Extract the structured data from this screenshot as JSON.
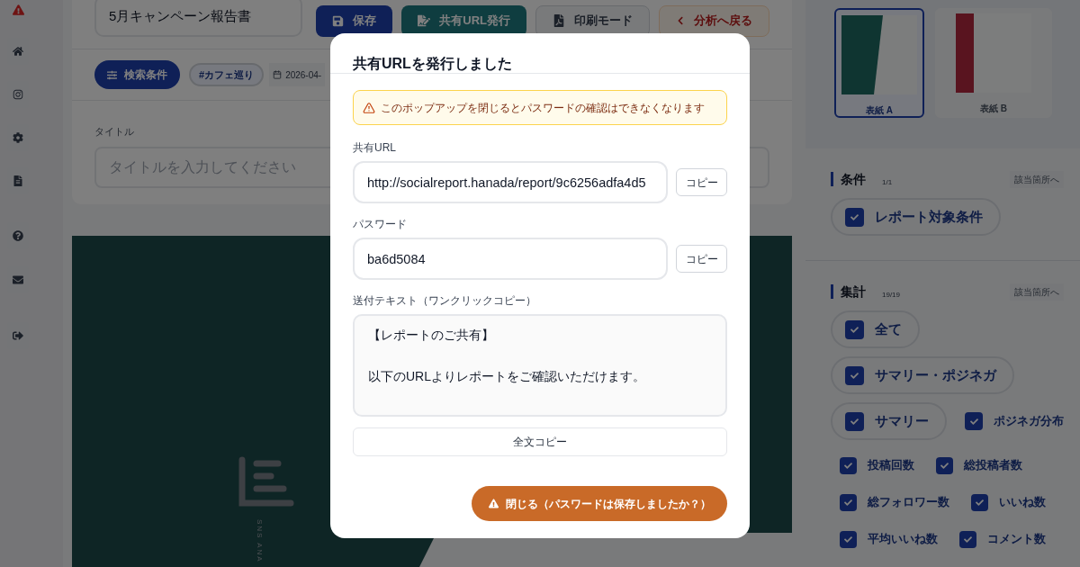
{
  "header": {
    "title_value": "5月キャンペーン報告書",
    "buttons": [
      {
        "label": "保存",
        "kind": "save"
      },
      {
        "label": "共有URL発行",
        "kind": "share"
      },
      {
        "label": "印刷モード",
        "kind": "print"
      },
      {
        "label": "分析へ戻る",
        "kind": "back"
      }
    ]
  },
  "filters": {
    "button": "検索条件",
    "tag": "#カフェ巡り",
    "date": "2026-04-"
  },
  "title_field": {
    "label": "タイトル",
    "placeholder": "タイトルを入力してください"
  },
  "cover_preview": {
    "caption": "SNS ANA"
  },
  "covers": [
    {
      "label": "表紙 A",
      "selected": true,
      "kind": "diagonal"
    },
    {
      "label": "表紙 B",
      "selected": false,
      "kind": "strip"
    }
  ],
  "sections": [
    {
      "title": "条件",
      "count": "1/1",
      "link": "該当箇所へ",
      "rows": [
        [
          {
            "label": "レポート対象条件",
            "checked": true,
            "kind": "chip"
          }
        ]
      ]
    },
    {
      "title": "集計",
      "count": "19/19",
      "link": "該当箇所へ",
      "rows": [
        [
          {
            "label": "全て",
            "checked": true,
            "kind": "chip"
          }
        ],
        [
          {
            "label": "サマリー・ポジネガ",
            "checked": true,
            "kind": "chip"
          }
        ],
        [
          {
            "label": "サマリー",
            "checked": true,
            "kind": "chip"
          },
          {
            "label": "ポジネガ分布",
            "checked": true,
            "kind": "plain"
          }
        ],
        [
          {
            "label": "投稿回数",
            "checked": true,
            "kind": "small"
          },
          {
            "label": "総投稿者数",
            "checked": true,
            "kind": "small"
          }
        ],
        [
          {
            "label": "総フォロワー数",
            "checked": true,
            "kind": "small"
          },
          {
            "label": "いいね数",
            "checked": true,
            "kind": "small"
          }
        ],
        [
          {
            "label": "平均いいね数",
            "checked": true,
            "kind": "small"
          },
          {
            "label": "コメント数",
            "checked": true,
            "kind": "small"
          }
        ]
      ]
    }
  ],
  "dialog": {
    "title": "共有URLを発行しました",
    "warning": "このポップアップを閉じるとパスワードの確認はできなくなります",
    "fields": [
      {
        "label": "共有URL",
        "value": "http://socialreport.hanada/report/9c6256adfa4d5",
        "button": "コピー"
      },
      {
        "label": "パスワード",
        "value": "ba6d5084",
        "button": "コピー"
      }
    ],
    "message": {
      "label": "送付テキスト（ワンクリックコピー）",
      "lines": [
        "【レポートのご共有】",
        "以下のURLよりレポートをご確認いただけます。"
      ]
    },
    "copy_all": "全文コピー",
    "close": "閉じる（パスワードは保存しましたか？）"
  }
}
